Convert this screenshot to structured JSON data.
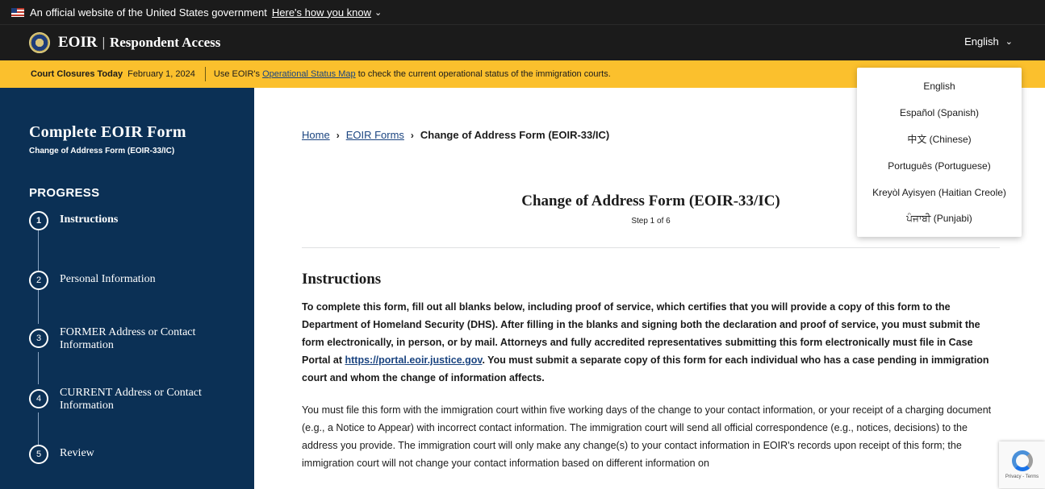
{
  "gov_banner": {
    "text": "An official website of the United States government",
    "link": "Here's how you know",
    "chevron": "⌄"
  },
  "header": {
    "brand_strong": "EOIR",
    "brand_sep": "|",
    "brand_sub": "Respondent Access",
    "language": "English",
    "chevron": "⌄"
  },
  "alert": {
    "label": "Court Closures Today",
    "date": "February 1, 2024",
    "text_before": "Use EOIR's",
    "link": "Operational Status Map",
    "text_after": "to check the current operational status of the immigration courts."
  },
  "sidebar": {
    "title": "Complete EOIR Form",
    "subtitle": "Change of Address Form (EOIR-33/IC)",
    "progress_heading": "PROGRESS",
    "steps": [
      {
        "num": "1",
        "label": "Instructions"
      },
      {
        "num": "2",
        "label": "Personal Information"
      },
      {
        "num": "3",
        "label": "FORMER Address or Contact Information"
      },
      {
        "num": "4",
        "label": "CURRENT Address or Contact Information"
      },
      {
        "num": "5",
        "label": "Review"
      }
    ]
  },
  "breadcrumb": {
    "home": "Home",
    "forms": "EOIR Forms",
    "current": "Change of Address Form (EOIR-33/IC)",
    "sep": "›"
  },
  "main": {
    "title": "Change of Address Form (EOIR-33/IC)",
    "step": "Step 1 of 6",
    "instructions_heading": "Instructions",
    "bold_para_1": "To complete this form, fill out all blanks below, including proof of service, which certifies that you will provide a copy of this form to the Department of Homeland Security (DHS). After filling in the blanks and signing both the declaration and proof of service, you must submit the form electronically, in person, or by mail. Attorneys and fully accredited representatives submitting this form electronically must file in Case Portal at",
    "portal_link": "https://portal.eoir.justice.gov",
    "bold_para_2": ". You must submit a separate copy of this form for each individual who has a case pending in immigration court and whom the change of information affects.",
    "para": "You must file this form with the immigration court within five working days of the change to your contact information, or your receipt of a charging document (e.g., a Notice to Appear) with incorrect contact information. The immigration court will send all official correspondence (e.g., notices, decisions) to the address you provide. The immigration court will only make any change(s) to your contact information in EOIR's records upon receipt of this form; the immigration court will not change your contact information based on different information on"
  },
  "language_menu": [
    "English",
    "Español (Spanish)",
    "中文 (Chinese)",
    "Português (Portuguese)",
    "Kreyòl Ayisyen (Haitian Creole)",
    "ਪੰਜਾਬੀ (Punjabi)"
  ],
  "recaptcha": {
    "text": "Privacy - Terms"
  }
}
